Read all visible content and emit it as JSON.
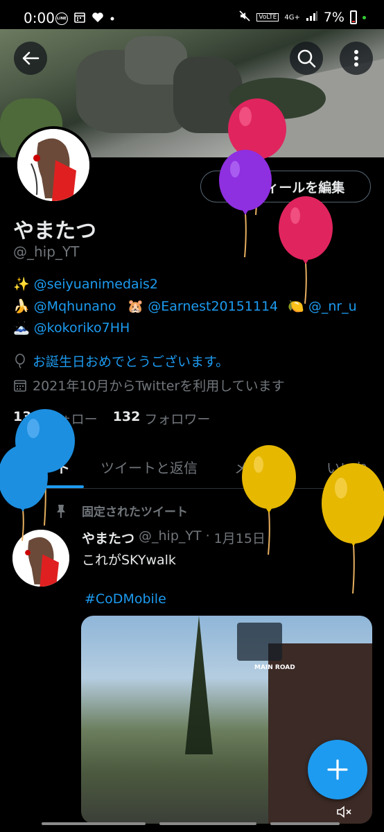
{
  "status_bar": {
    "time": "0:00",
    "line_badge": "LINE",
    "battery_text": "7%",
    "network": "4G+",
    "volte": "VoLTE"
  },
  "header": {
    "back_icon": "arrow-left-icon",
    "search_icon": "search-icon",
    "more_icon": "more-vertical-icon"
  },
  "profile": {
    "name": "やまたつ",
    "handle": "@_hip_YT",
    "edit_button": "プロフィールを編集",
    "bio": {
      "line1": {
        "emoji": "✨",
        "mention": "@seiyuanimedais2"
      },
      "line2": [
        {
          "emoji": "🍌",
          "mention": "@Mqhunano"
        },
        {
          "emoji": "🐹",
          "mention": "@Earnest20151114"
        },
        {
          "emoji": "🍋",
          "mention": "@_nr_u"
        }
      ],
      "line3": {
        "emoji": "🗻",
        "mention": "@kokoriko7HH"
      }
    },
    "birthday": "お誕生日おめでとうございます。",
    "joined": "2021年10月からTwitterを利用しています",
    "following_count": "138",
    "following_label": "フォロー",
    "followers_count": "132",
    "followers_label": "フォロワー"
  },
  "tabs": [
    "ツイート",
    "ツイートと返信",
    "メディア",
    "いいね"
  ],
  "pinned": {
    "label": "固定されたツイート",
    "author_name": "やまたつ",
    "author_handle": "@_hip_YT",
    "separator": "·",
    "date": "1月15日",
    "text": "これがSKYwalk",
    "hashtag": "#CoDMobile",
    "media_label": "MAIN ROAD"
  },
  "fab": {
    "icon": "plus-icon"
  },
  "colors": {
    "accent": "#1d9bf0",
    "background": "#000000",
    "text": "#e7e9ea",
    "muted": "#71767b",
    "balloon_red": "#e0245e",
    "balloon_purple": "#8e2fe0",
    "balloon_blue": "#1d9bf0",
    "balloon_yellow": "#f2c70e"
  }
}
